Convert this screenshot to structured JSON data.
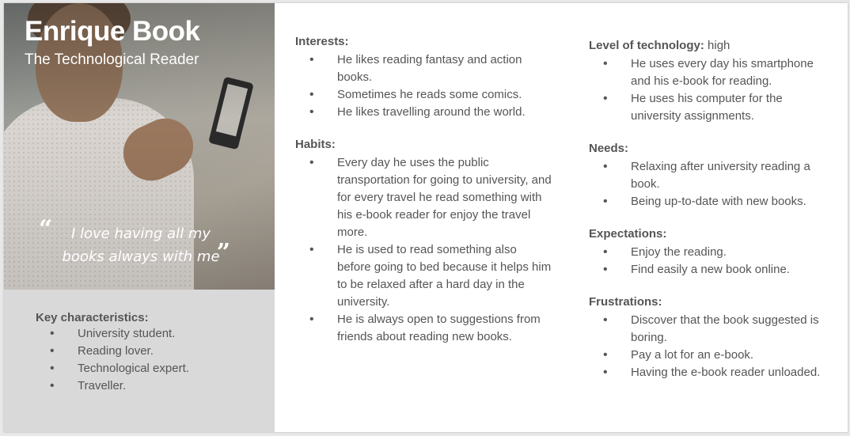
{
  "persona": {
    "name": "Enrique Book",
    "subtitle": "The Technological Reader",
    "quote": "I love having all my books always with me",
    "quote_open": "“",
    "quote_close": "”"
  },
  "key_characteristics": {
    "title": "Key characteristics:",
    "items": [
      "University student.",
      "Reading lover.",
      "Technological expert.",
      "Traveller."
    ]
  },
  "interests": {
    "title": "Interests:",
    "items": [
      "He likes reading fantasy and action books.",
      "Sometimes he reads some comics.",
      "He likes travelling around the world."
    ]
  },
  "habits": {
    "title": "Habits:",
    "items": [
      "Every day he uses the public transportation for going to university, and for every travel he read something with his e-book reader for enjoy the travel more.",
      "He is used to read something also before going to bed because it helps him to be relaxed after a hard day in the university.",
      "He is always open to suggestions from friends about reading new books."
    ]
  },
  "technology": {
    "title": "Level of technology:",
    "value": " high",
    "items": [
      "He uses every day his smartphone and his e-book for reading.",
      "He uses his computer for the university assignments."
    ]
  },
  "needs": {
    "title": "Needs:",
    "items": [
      "Relaxing after university reading a book.",
      "Being up-to-date with new books."
    ]
  },
  "expectations": {
    "title": "Expectations:",
    "items": [
      "Enjoy the reading.",
      "Find easily a new book online."
    ]
  },
  "frustrations": {
    "title": "Frustrations:",
    "items": [
      "Discover that the book suggested is boring.",
      "Pay a lot for an e-book.",
      "Having the e-book reader unloaded."
    ]
  }
}
